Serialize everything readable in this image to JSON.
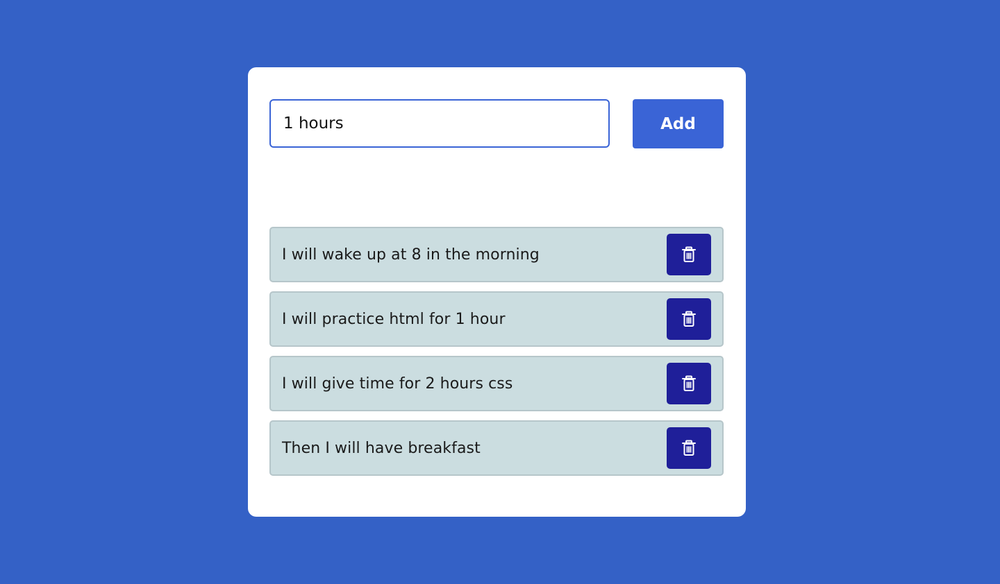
{
  "form": {
    "input_value": "1 hours",
    "add_label": "Add"
  },
  "todos": [
    {
      "text": "I will wake up at 8 in the morning",
      "delete_icon": "trash-icon"
    },
    {
      "text": "I will practice html for 1 hour",
      "delete_icon": "trash-icon"
    },
    {
      "text": "I will give time for 2 hours css",
      "delete_icon": "trash-icon"
    },
    {
      "text": "Then I will have breakfast",
      "delete_icon": "trash-icon"
    }
  ],
  "colors": {
    "background": "#3461c6",
    "accent": "#3a64d6",
    "delete_button": "#1f1f99",
    "item_background": "#cbdde0"
  }
}
